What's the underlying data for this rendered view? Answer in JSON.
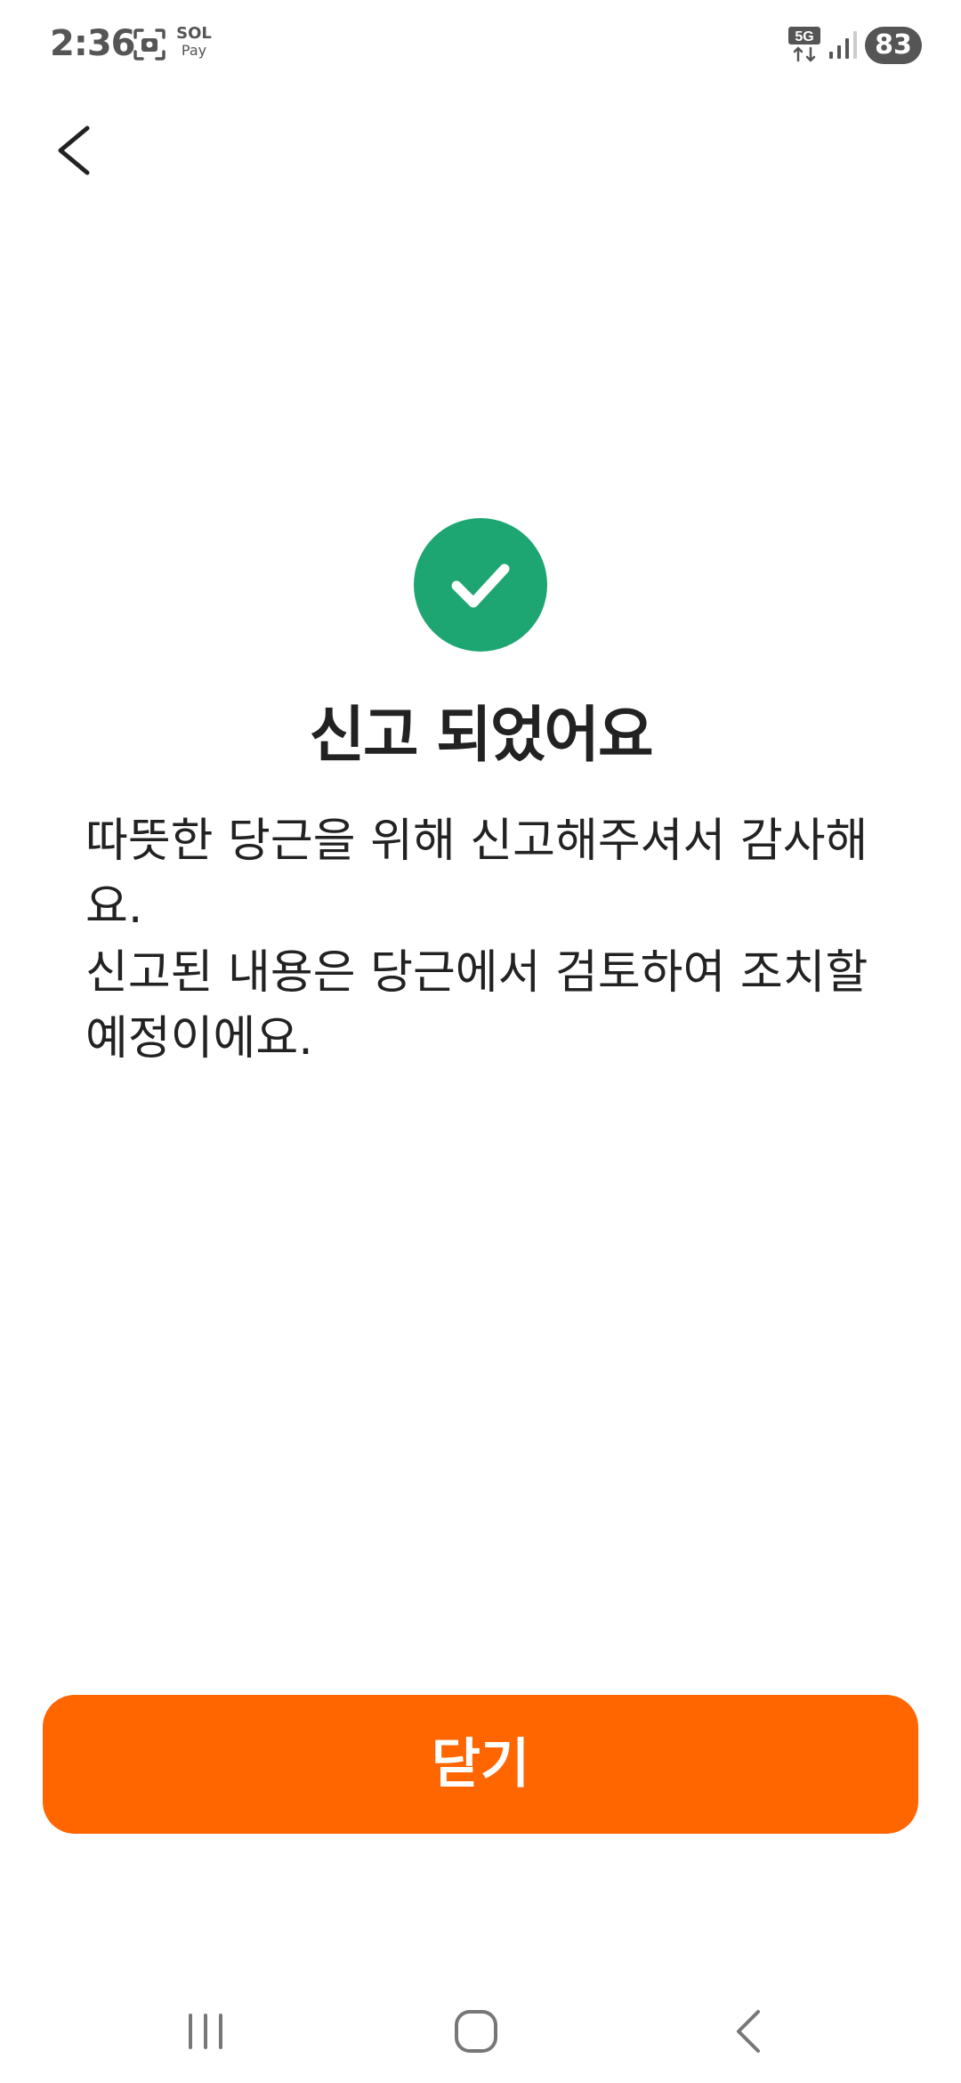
{
  "status_bar": {
    "time": "2:36",
    "sol_label": "SOL",
    "pay_label": "Pay",
    "network_label": "5G",
    "battery": "83",
    "icons": [
      "screenshot-icon",
      "signal-icon"
    ]
  },
  "header": {
    "back_icon": "chevron-left-icon"
  },
  "main": {
    "icon": "check-circle-icon",
    "title": "신고 되었어요",
    "message_line1": "따뜻한 당근을 위해 신고해주셔서 감사해요.",
    "message_line2": "신고된 내용은 당근에서 검토하여 조치할 예정이에요."
  },
  "footer": {
    "close_label": "닫기"
  },
  "nav_bar": {
    "icons": [
      "recent-apps-icon",
      "home-icon",
      "back-icon"
    ]
  },
  "colors": {
    "accent": "#ff6600",
    "success": "#1ea672",
    "text": "#222222",
    "status_text": "#555555"
  }
}
